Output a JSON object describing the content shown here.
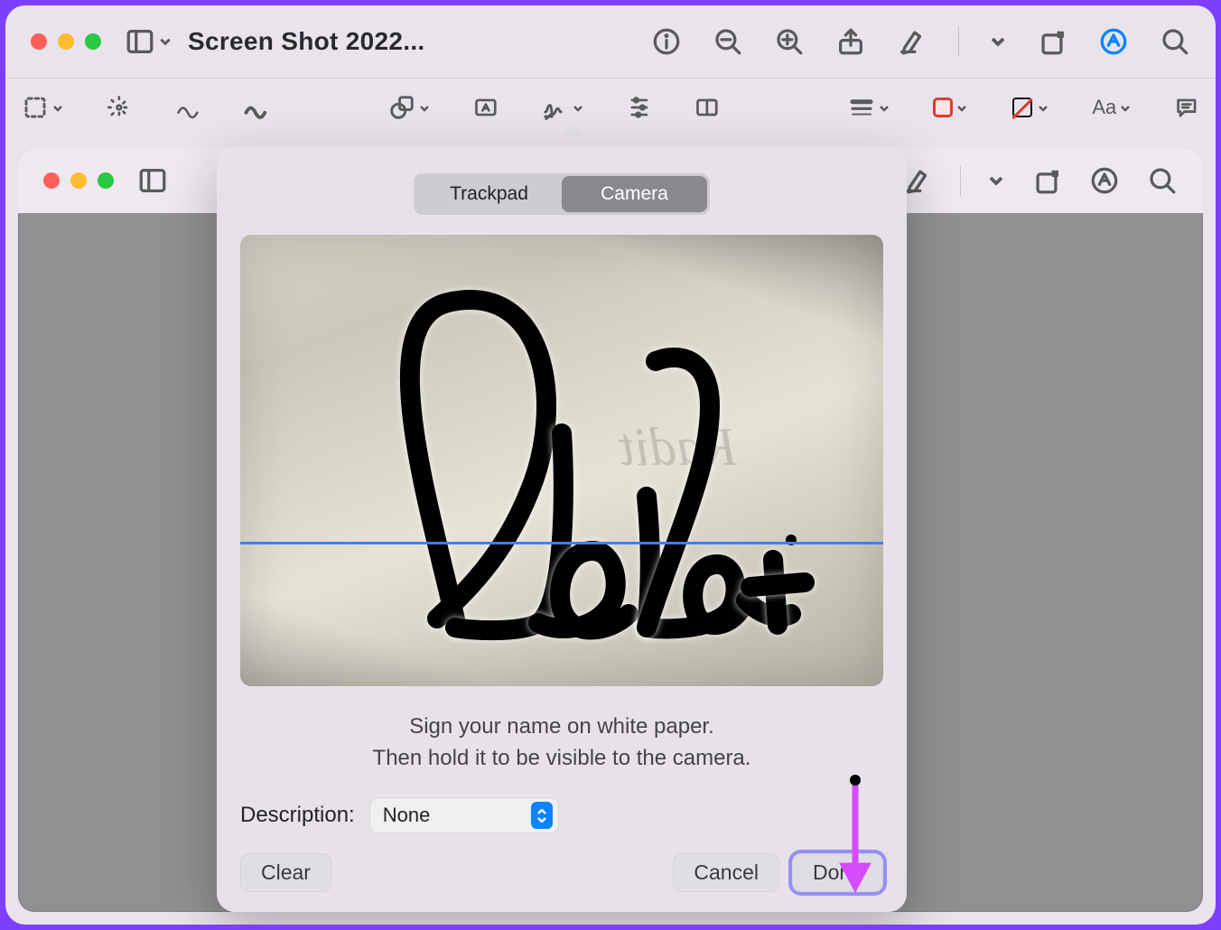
{
  "window": {
    "title": "Screen Shot 2022..."
  },
  "markup_toolbar": {
    "text_style_label": "Aa"
  },
  "sheet": {
    "tab_trackpad": "Trackpad",
    "tab_camera": "Camera",
    "active_tab": "Camera",
    "signature_text": "Radit",
    "hint_line1": "Sign your name on white paper.",
    "hint_line2": "Then hold it to be visible to the camera.",
    "description_label": "Description:",
    "description_value": "None",
    "clear": "Clear",
    "cancel": "Cancel",
    "done": "Done"
  }
}
